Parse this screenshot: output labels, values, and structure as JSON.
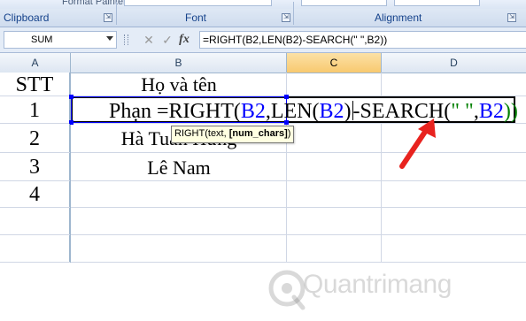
{
  "ribbon": {
    "format_painter_label": "Format Painter",
    "groups": [
      {
        "label": "Clipboard"
      },
      {
        "label": "Font"
      },
      {
        "label": "Alignment"
      }
    ],
    "launcher_glyph": "⇲"
  },
  "formula_bar": {
    "name_box_value": "SUM",
    "cancel_glyph": "✕",
    "enter_glyph": "✓",
    "fx_label": "fx",
    "formula_text": "=RIGHT(B2,LEN(B2)-SEARCH(\" \",B2))"
  },
  "columns": [
    {
      "letter": "A"
    },
    {
      "letter": "B"
    },
    {
      "letter": "C"
    },
    {
      "letter": "D"
    }
  ],
  "rows": [
    {
      "a": "STT",
      "b": "Họ và tên"
    },
    {
      "a": "1",
      "b": "Phạn"
    },
    {
      "a": "2",
      "b": "Hà Tuấn Hưng"
    },
    {
      "a": "3",
      "b": "Lê Nam"
    },
    {
      "a": "4",
      "b": ""
    },
    {
      "a": "",
      "b": ""
    },
    {
      "a": "",
      "b": ""
    }
  ],
  "edit": {
    "prefix": "Phạn =RIGHT(",
    "ref1": "B2",
    "sep1": ",LEN(",
    "ref2": "B2",
    "sep2": ")",
    "after_caret": "-SEARCH(",
    "space_literal": "\" \"",
    "sep3": ",",
    "ref3": "B2",
    "closing": "))"
  },
  "tooltip": {
    "fn_part": "RIGHT(text, ",
    "bold_arg": "[num_chars]",
    "closing": ")"
  },
  "watermark": {
    "text": "Quantrimang",
    "icon": "quantrimang-logo-icon"
  },
  "colors": {
    "ref_blue": "#0000ff",
    "ref_green": "#008000",
    "arrow_red": "#e8231f",
    "ribbon_label": "#15428b"
  }
}
